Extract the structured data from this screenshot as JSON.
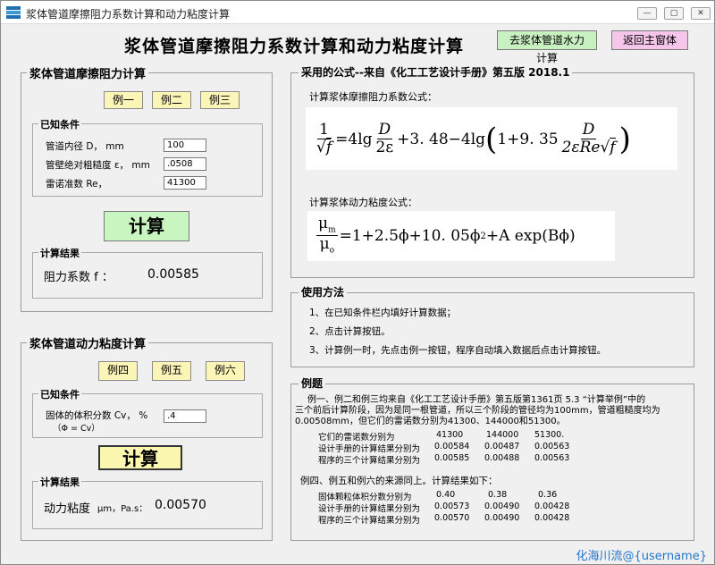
{
  "window": {
    "title": "浆体管道摩擦阻力系数计算和动力粘度计算",
    "controls": [
      "—",
      "▢",
      "✕"
    ]
  },
  "header": {
    "title": "浆体管道摩擦阻力系数计算和动力粘度计算",
    "water_button": "去浆体管道水力计算",
    "return_button": "返回主窗体"
  },
  "friction": {
    "title": "浆体管道摩擦阻力计算",
    "examples": [
      "例一",
      "例二",
      "例三"
    ],
    "known_title": "已知条件",
    "fields": [
      {
        "label": "管道内径 D， mm",
        "value": "100"
      },
      {
        "label": "管壁绝对粗糙度 ε， mm",
        "value": ".0508"
      },
      {
        "label": "雷诺准数 Re，",
        "value": "41300"
      }
    ],
    "calc_button": "计算",
    "result_title": "计算结果",
    "result_label": "阻力系数 f ：",
    "result_value": "0.00585"
  },
  "viscosity": {
    "title": "浆体管道动力粘度计算",
    "examples": [
      "例四",
      "例五",
      "例六"
    ],
    "known_title": "已知条件",
    "field_label": "固体的体积分数 Cv， %",
    "field_sub": "（Φ = Cv）",
    "field_value": ".4",
    "calc_button": "计算",
    "result_title": "计算结果",
    "result_label": "动力粘度",
    "result_symbol": "μm，Pa.s：",
    "result_value": "0.00570"
  },
  "formulas": {
    "title": "采用的公式--来自《化工工艺设计手册》第五版    2018.1",
    "friction_caption": "计算浆体摩擦阻力系数公式：",
    "viscosity_caption": "计算浆体动力粘度公式：",
    "f1": {
      "one": "1",
      "sqrt_f": "f",
      "eq": "=4lg",
      "D": "D",
      "two_eps": "2ε",
      "plus_348": "+3. 48−4lg",
      "paren_open": "(",
      "one_plus": "1+9. 35",
      "den2": "2εRe",
      "paren_close": ")"
    },
    "f2": {
      "mu_m": "μ",
      "sub_m": "m",
      "mu_o": "μ",
      "sub_o": "o",
      "rhs": "=1+2.5ϕ+10. 05ϕ",
      "sq": "2",
      "rhs2": "+A exp(Bϕ)"
    }
  },
  "usage": {
    "title": "使用方法",
    "lines": [
      "1、在已知条件栏内填好计算数据；",
      "2、点击计算按钮。",
      "3、计算例一时，先点击例一按钮，程序自动填入数据后点击计算按钮。"
    ]
  },
  "examples_panel": {
    "title": "例题",
    "intro_lines": [
      "例一、例二和例三均来自《化工工艺设计手册》第五版第1361页 5.3 “计算举例”中的",
      "三个前后计算阶段，因为是同一根管道，所以三个阶段的管径均为100mm，管道粗糙度均为",
      "0.00508mm，但它们的雷诺数分别为41300、144000和51300。"
    ],
    "table1": [
      {
        "label": "它们的雷诺数分别为",
        "values": [
          "41300",
          "144000",
          "51300."
        ]
      },
      {
        "label": "设计手册的计算结果分别为",
        "values": [
          "0.00584",
          "0.00487",
          "0.00563"
        ]
      },
      {
        "label": "程序的三个计算结果分别为",
        "values": [
          "0.00585",
          "0.00488",
          "0.00563"
        ]
      }
    ],
    "intro2": "例四、例五和例六的来源同上。计算结果如下：",
    "table2": [
      {
        "label": "固体颗粒体积分数分别为",
        "values": [
          "0.40",
          "0.38",
          "0.36"
        ]
      },
      {
        "label": "设计手册的计算结果分别为",
        "values": [
          "0.00573",
          "0.00490",
          "0.00428"
        ]
      },
      {
        "label": "程序的三个计算结果分别为",
        "values": [
          "0.00570",
          "0.00490",
          "0.00428"
        ]
      }
    ]
  },
  "watermark": "化海川流@{username}",
  "colors": {
    "green_button": "#c9f0c0",
    "pink_button": "#f6c6ea",
    "yellow_button": "#fbf5b8",
    "calc_green": "#c8f5c0",
    "calc_yellow": "#fcf7b0",
    "watermark": "#2277cc"
  }
}
